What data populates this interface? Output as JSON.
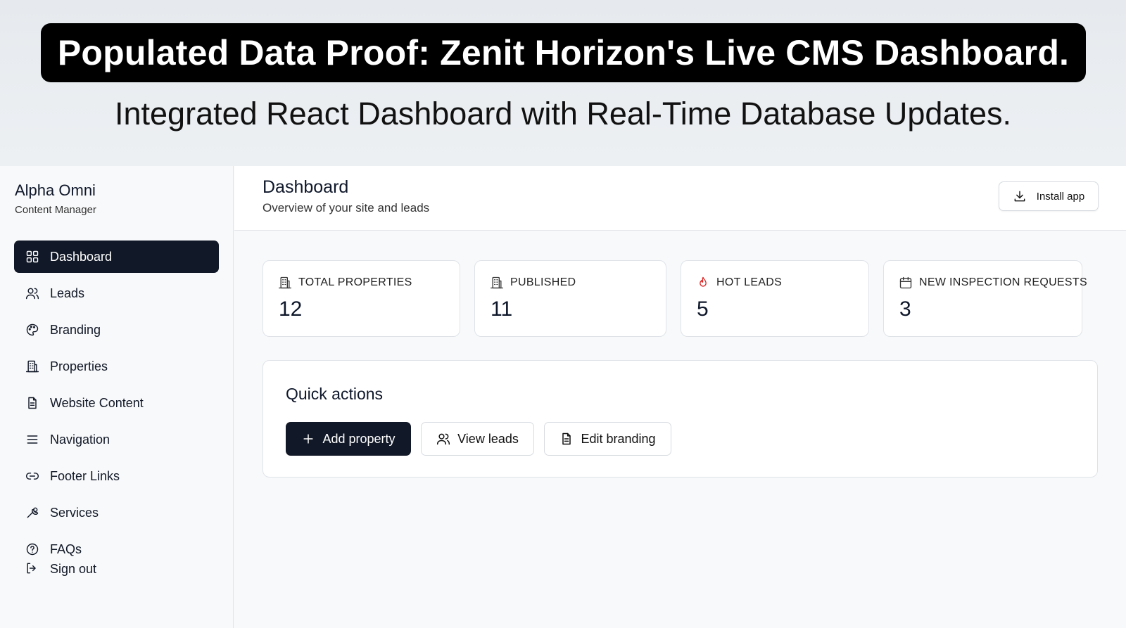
{
  "banner": {
    "headline": "Populated Data Proof: Zenit Horizon's Live CMS Dashboard.",
    "subheadline": "Integrated React Dashboard with Real-Time Database Updates."
  },
  "sidebar": {
    "brand_name": "Alpha Omni",
    "brand_role": "Content Manager",
    "items": [
      {
        "label": "Dashboard",
        "icon": "grid-icon",
        "active": true
      },
      {
        "label": "Leads",
        "icon": "users-icon"
      },
      {
        "label": "Branding",
        "icon": "palette-icon"
      },
      {
        "label": "Properties",
        "icon": "building-icon"
      },
      {
        "label": "Website Content",
        "icon": "file-icon"
      },
      {
        "label": "Navigation",
        "icon": "menu-icon"
      },
      {
        "label": "Footer Links",
        "icon": "link-icon"
      },
      {
        "label": "Services",
        "icon": "wrench-icon"
      },
      {
        "label": "FAQs",
        "icon": "help-circle-icon"
      }
    ],
    "signout_label": "Sign out"
  },
  "header": {
    "title": "Dashboard",
    "subtitle": "Overview of your site and leads",
    "install_label": "Install app"
  },
  "stats": [
    {
      "label": "TOTAL PROPERTIES",
      "value": "12",
      "icon": "building-icon"
    },
    {
      "label": "PUBLISHED",
      "value": "11",
      "icon": "building-icon"
    },
    {
      "label": "HOT LEADS",
      "value": "5",
      "icon": "flame-icon",
      "icon_color": "#dc2626"
    },
    {
      "label": "NEW INSPECTION REQUESTS",
      "value": "3",
      "icon": "calendar-icon"
    }
  ],
  "quick_actions": {
    "title": "Quick actions",
    "add_property": "Add property",
    "view_leads": "View leads",
    "edit_branding": "Edit branding"
  },
  "colors": {
    "primary": "#111827",
    "flame": "#dc2626"
  }
}
